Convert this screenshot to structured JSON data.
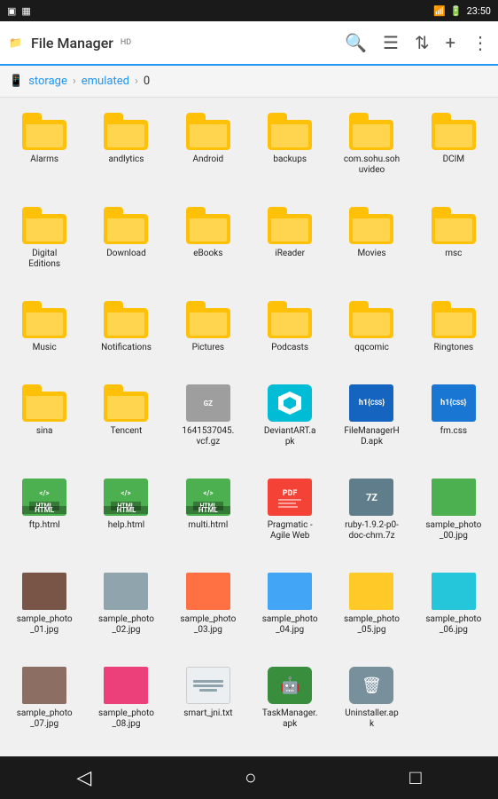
{
  "statusBar": {
    "time": "23:50",
    "battery": "100",
    "wifi": true,
    "leftIcons": [
      "sim-icon",
      "signal-icon"
    ]
  },
  "toolbar": {
    "title": "File Manager",
    "titleSuffix": "HD",
    "icons": [
      "search",
      "list-view",
      "sort",
      "add",
      "more"
    ]
  },
  "breadcrumb": {
    "items": [
      "storage",
      "emulated",
      "0"
    ]
  },
  "files": [
    {
      "name": "Alarms",
      "type": "folder"
    },
    {
      "name": "andlytics",
      "type": "folder"
    },
    {
      "name": "Android",
      "type": "folder"
    },
    {
      "name": "backups",
      "type": "folder"
    },
    {
      "name": "com.sohu.soh\nuvideo",
      "type": "folder"
    },
    {
      "name": "DCIM",
      "type": "folder"
    },
    {
      "name": "Digital\nEditions",
      "type": "folder"
    },
    {
      "name": "Download",
      "type": "folder"
    },
    {
      "name": "eBooks",
      "type": "folder"
    },
    {
      "name": "iReader",
      "type": "folder"
    },
    {
      "name": "Movies",
      "type": "folder"
    },
    {
      "name": "msc",
      "type": "folder"
    },
    {
      "name": "Music",
      "type": "folder"
    },
    {
      "name": "Notifications",
      "type": "folder"
    },
    {
      "name": "Pictures",
      "type": "folder"
    },
    {
      "name": "Podcasts",
      "type": "folder"
    },
    {
      "name": "qqcomic",
      "type": "folder"
    },
    {
      "name": "Ringtones",
      "type": "folder"
    },
    {
      "name": "sina",
      "type": "folder"
    },
    {
      "name": "Tencent",
      "type": "folder"
    },
    {
      "name": "1641537045.\nvcf.gz",
      "type": "gz"
    },
    {
      "name": "DeviantART.a\npk",
      "type": "apk-deviant"
    },
    {
      "name": "FileManagerH\nD.apk",
      "type": "apk-fm"
    },
    {
      "name": "fm.css",
      "type": "css"
    },
    {
      "name": "ftp.html",
      "type": "html"
    },
    {
      "name": "help.html",
      "type": "html"
    },
    {
      "name": "multi.html",
      "type": "html"
    },
    {
      "name": "Pragmatic -\nAgile Web",
      "type": "pdf"
    },
    {
      "name": "ruby-1.9.2-p0-\ndoc-chm.7z",
      "type": "7z"
    },
    {
      "name": "sample_photo\n_00.jpg",
      "type": "photo",
      "color": "#4CAF50"
    },
    {
      "name": "sample_photo\n_01.jpg",
      "type": "photo",
      "color": "#795548"
    },
    {
      "name": "sample_photo\n_02.jpg",
      "type": "photo",
      "color": "#90A4AE"
    },
    {
      "name": "sample_photo\n_03.jpg",
      "type": "photo",
      "color": "#FF7043"
    },
    {
      "name": "sample_photo\n_04.jpg",
      "type": "photo",
      "color": "#42A5F5"
    },
    {
      "name": "sample_photo\n_05.jpg",
      "type": "photo",
      "color": "#FFCA28"
    },
    {
      "name": "sample_photo\n_06.jpg",
      "type": "photo",
      "color": "#26C6DA"
    },
    {
      "name": "sample_photo\n_07.jpg",
      "type": "photo",
      "color": "#8D6E63"
    },
    {
      "name": "sample_photo\n_08.jpg",
      "type": "photo",
      "color": "#EC407A"
    },
    {
      "name": "smart_jni.txt",
      "type": "txt"
    },
    {
      "name": "TaskManager.\napk",
      "type": "apk-task"
    },
    {
      "name": "Uninstaller.ap\nk",
      "type": "apk-uninstall"
    }
  ],
  "bottomNav": {
    "back": "◁",
    "home": "○",
    "recent": "□"
  }
}
